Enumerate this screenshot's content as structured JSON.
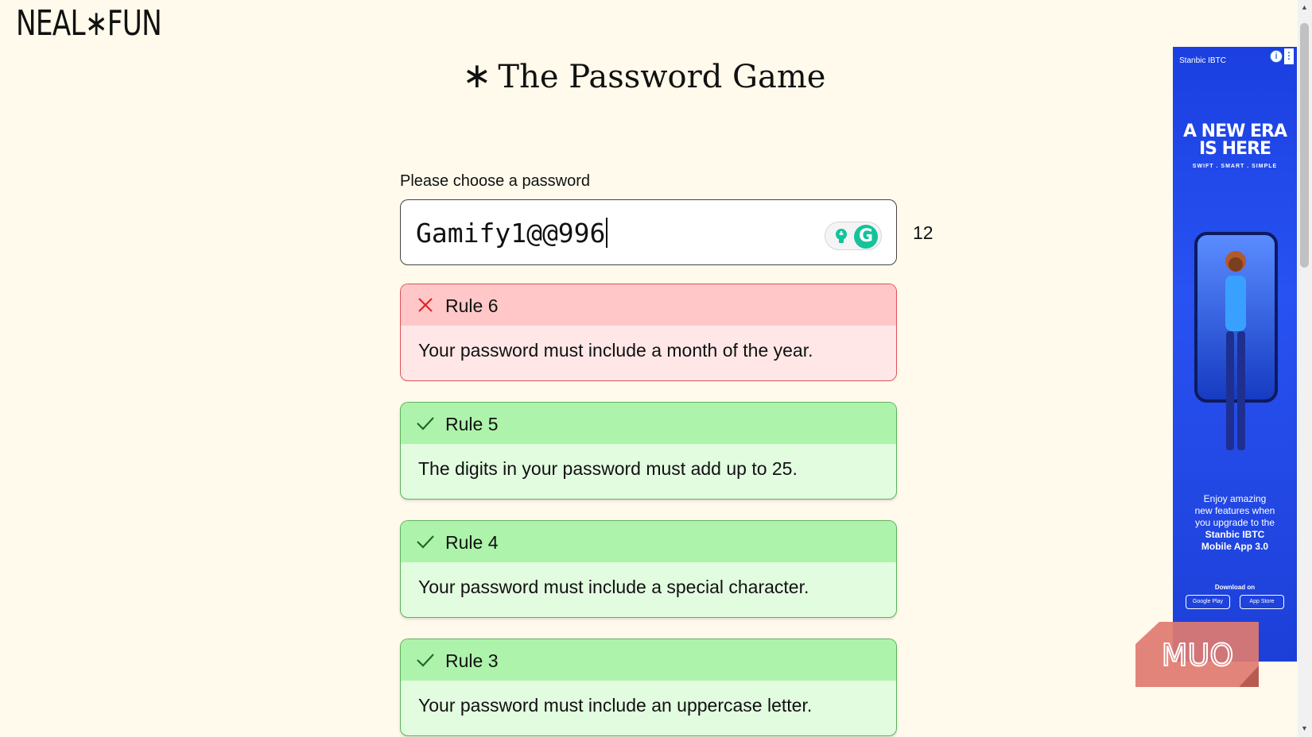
{
  "logo": "NEAL∗FUN",
  "title": {
    "star": "∗",
    "text": "The Password Game"
  },
  "password": {
    "label": "Please choose a password",
    "value": "Gamify1@@996",
    "char_count": "12"
  },
  "rules": [
    {
      "name": "Rule 6",
      "text": "Your password must include a month of the year.",
      "status": "fail"
    },
    {
      "name": "Rule 5",
      "text": "The digits in your password must add up to 25.",
      "status": "pass"
    },
    {
      "name": "Rule 4",
      "text": "Your password must include a special character.",
      "status": "pass"
    },
    {
      "name": "Rule 3",
      "text": "Your password must include an uppercase letter.",
      "status": "pass"
    }
  ],
  "ad": {
    "brand": "Stanbic IBTC",
    "headline_line1": "A NEW ERA",
    "headline_line2": "IS HERE",
    "subline": "SWIFT . SMART . SIMPLE",
    "body_line1": "Enjoy amazing",
    "body_line2": "new features when",
    "body_line3": "you upgrade to the",
    "body_bold1": "Stanbic IBTC",
    "body_bold2": "Mobile App 3.0",
    "download": "Download on",
    "store1": "Google Play",
    "store2": "App Store"
  },
  "watermark": "MUO",
  "colors": {
    "background": "#fffaeb",
    "fail_border": "#e0525b",
    "fail_header": "#ffc7c7",
    "pass_header": "#aef3ab",
    "pass_body": "#e2fce0",
    "ad_blue": "#2852f2"
  }
}
